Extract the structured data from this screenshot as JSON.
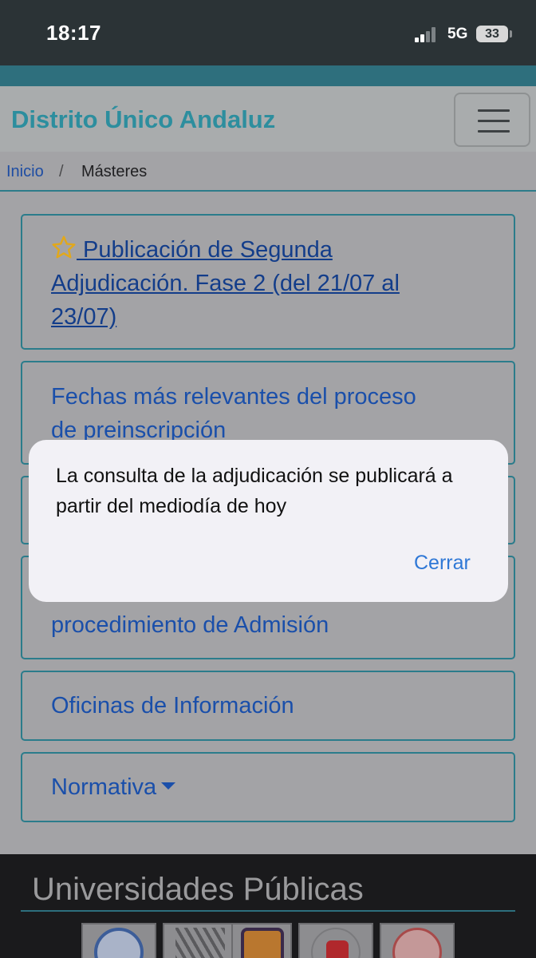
{
  "status_bar": {
    "time": "18:17",
    "network": "5G",
    "battery": "33"
  },
  "navbar": {
    "brand": "Distrito Único Andaluz",
    "menu_icon": "hamburger-menu-icon"
  },
  "breadcrumb": {
    "home": "Inicio",
    "separator": "/",
    "current": "Másteres"
  },
  "cards": [
    {
      "line1": " Publicación de Segunda",
      "line2": "Adjudicación. Fase 2 (del 21/07 al",
      "line3": "23/07)",
      "icon": "star-icon"
    },
    {
      "line1": "Fechas más relevantes del proceso",
      "line2": "de preinscripción"
    },
    {
      "line1": ""
    },
    {
      "line1": "procedimiento de Admisión"
    },
    {
      "line1": "Oficinas de Información"
    },
    {
      "line1": "Normativa",
      "icon": "caret-down-icon"
    }
  ],
  "footer": {
    "title": "Universidades Públicas"
  },
  "alert": {
    "message": "La consulta de la adjudicación se publicará a partir del mediodía de hoy",
    "button": "Cerrar"
  },
  "colors": {
    "teal": "#2d8e9e",
    "link": "#1a4faa",
    "ios_blue": "#2f78d6",
    "star": "#e2a81b"
  }
}
